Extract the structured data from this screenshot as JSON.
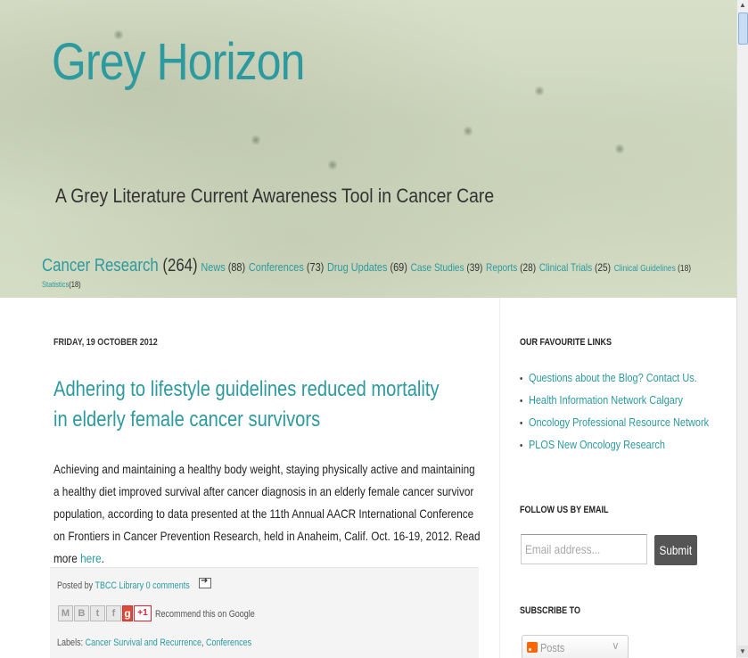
{
  "header": {
    "title": "Grey Horizon",
    "description": "A Grey Literature Current Awareness Tool in Cancer Care"
  },
  "labels": [
    {
      "name": "Cancer Research",
      "count": "(264)"
    },
    {
      "name": "News",
      "count": "(88)"
    },
    {
      "name": "Conferences",
      "count": "(73)"
    },
    {
      "name": "Drug Updates",
      "count": "(69)"
    },
    {
      "name": "Case Studies",
      "count": "(39)"
    },
    {
      "name": "Reports",
      "count": "(28)"
    },
    {
      "name": "Clinical Trials",
      "count": "(25)"
    },
    {
      "name": "Clinical Guidelines",
      "count": "(18)"
    },
    {
      "name": "Statistics",
      "count": "(18)"
    }
  ],
  "post": {
    "date": "FRIDAY, 19 OCTOBER 2012",
    "title": "Adhering to lifestyle guidelines reduced mortality in elderly female cancer survivors",
    "body": "Achieving and maintaining a healthy body weight, staying physically active and maintaining a healthy diet improved survival after cancer diagnosis in an elderly female cancer survivor population, according to data presented at the 11th Annual AACR International Conference on Frontiers in Cancer Prevention Research, held in Anaheim, Calif. Oct. 16-19, 2012. Read more",
    "read_more_link": "here",
    "period": ".",
    "posted_by_label": "Posted by",
    "author": "TBCC Library",
    "comments": "0 comments",
    "share": {
      "email": "M",
      "blog": "B",
      "twitter": "t",
      "facebook": "f",
      "gplus_logo": "g",
      "plus_one": "+1",
      "recommend": "Recommend this on Google"
    },
    "labels_prefix": "Labels:",
    "post_labels": [
      "Cancer Survival and Recurrence",
      "Conferences"
    ],
    "labels_separator": ","
  },
  "sidebar": {
    "favourite_links_heading": "OUR FAVOURITE LINKS",
    "links": [
      "Questions about the Blog? Contact Us.",
      "Health Information Network Calgary",
      "Oncology Professional Resource Network",
      "PLOS New Oncology Research"
    ],
    "follow_heading": "FOLLOW US BY EMAIL",
    "email_placeholder": "Email address...",
    "submit_label": "Submit",
    "subscribe_heading": "SUBSCRIBE TO",
    "subscribe_option": "Posts"
  },
  "icons": {
    "bullet": "•",
    "chevron": "∨",
    "scroll_up": "▲",
    "scroll_down": "▼"
  },
  "colors": {
    "accent": "#2c9a9e",
    "header_bg": "#d4dcc4",
    "submit_bg": "#555555",
    "feed": "#ff6600"
  }
}
